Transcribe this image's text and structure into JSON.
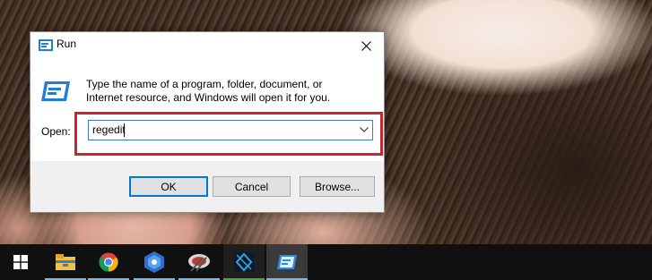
{
  "dialog": {
    "title": "Run",
    "description": "Type the name of a program, folder, document, or Internet resource, and Windows will open it for you.",
    "open_label": "Open:",
    "open_value": "regedit",
    "ok_label": "OK",
    "cancel_label": "Cancel",
    "browse_label": "Browse...",
    "highlight_color": "#c8272f"
  },
  "taskbar": {
    "items": [
      {
        "icon": "windows-start-icon"
      },
      {
        "icon": "file-explorer-icon"
      },
      {
        "icon": "chrome-icon"
      },
      {
        "icon": "blue-app-icon"
      },
      {
        "icon": "snipping-tool-icon"
      },
      {
        "icon": "dark-app-icon"
      },
      {
        "icon": "run-icon"
      }
    ]
  },
  "colors": {
    "accent": "#0078d7",
    "taskbar": "#101010"
  }
}
